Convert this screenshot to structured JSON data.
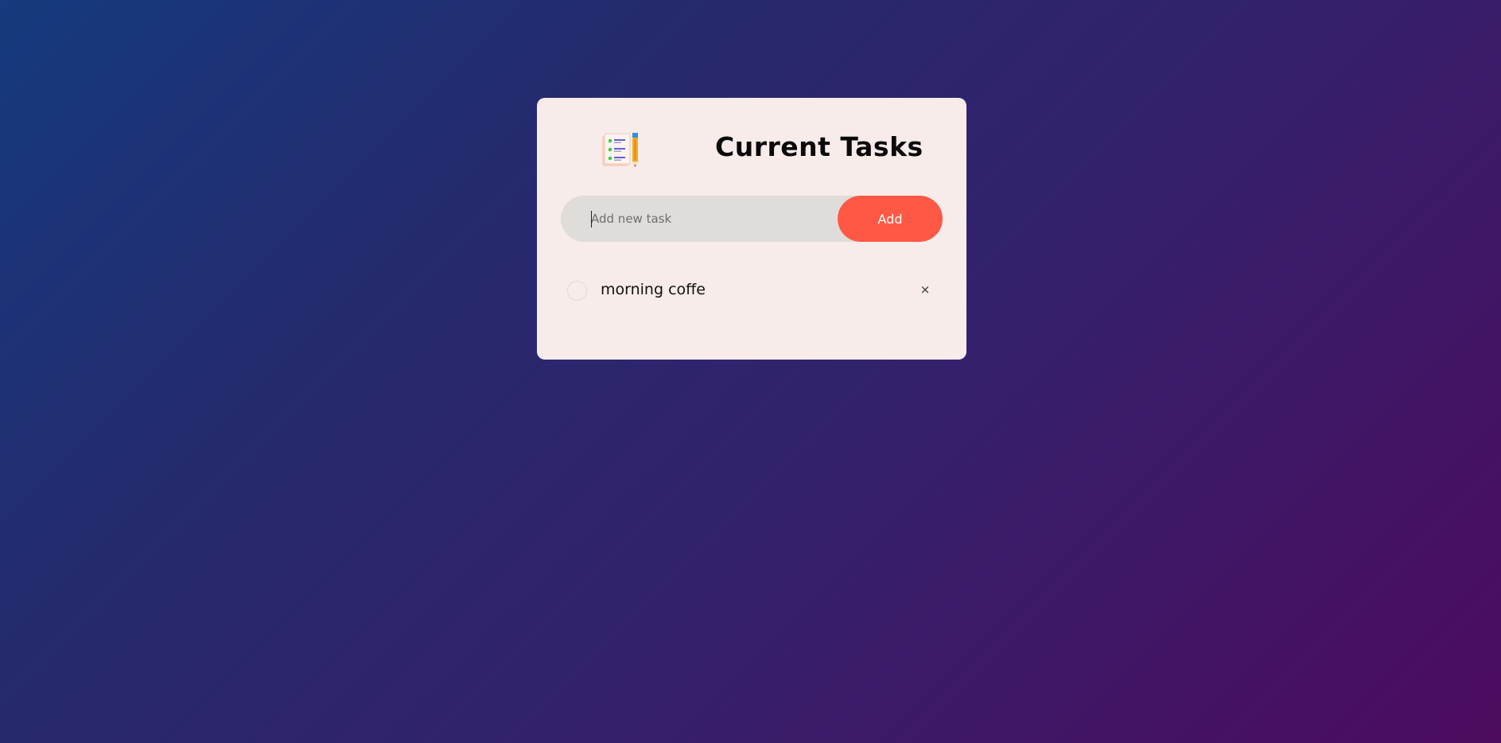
{
  "header": {
    "logo_icon": "checklist-notepad-pencil-icon",
    "title": "Current Tasks"
  },
  "input": {
    "placeholder": "Add new task",
    "value": ""
  },
  "add_button": {
    "label": "Add"
  },
  "tasks": [
    {
      "text": "morning coffe",
      "checked": false,
      "delete_glyph": "×"
    }
  ],
  "colors": {
    "accent": "#ff5945",
    "card_background": "#f7ecea",
    "input_background": "#e0dcda"
  }
}
